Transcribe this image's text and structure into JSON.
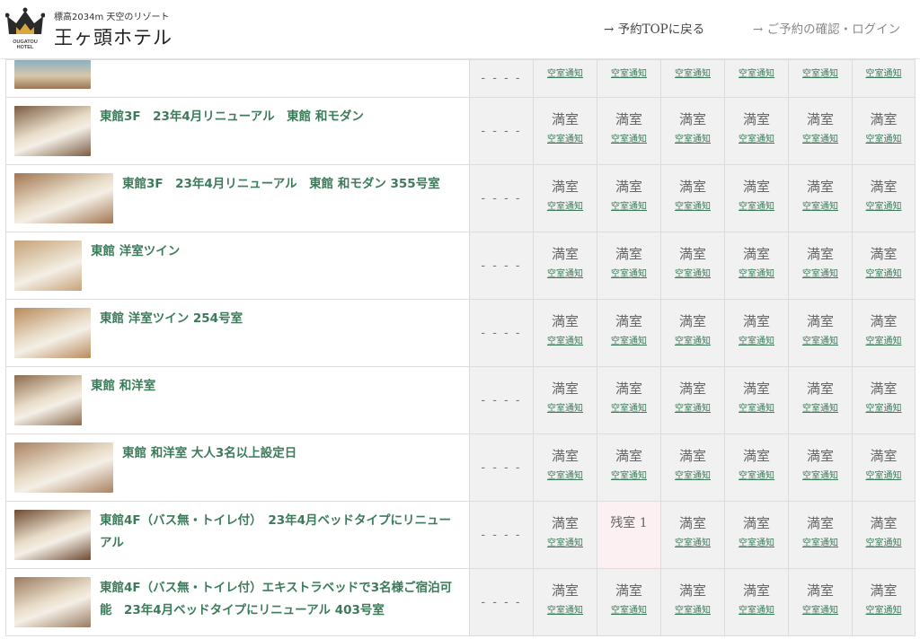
{
  "header": {
    "logo_text": "OUGATOU HOTEL",
    "tagline": "標高2034m 天空のリゾート",
    "hotel_name": "王ヶ頭ホテル",
    "nav_top": "→ 予約TOPに戻る",
    "nav_login": "→ ご予約の確認・ログイン"
  },
  "labels": {
    "full": "満室",
    "notify": "空室通知",
    "dash": "- - - -"
  },
  "partial_row": {
    "dash": "- - - -",
    "days": [
      {
        "notify": "空室通知"
      },
      {
        "notify": "空室通知"
      },
      {
        "notify": "空室通知"
      },
      {
        "notify": "空室通知"
      },
      {
        "notify": "空室通知"
      },
      {
        "notify": "空室通知"
      }
    ]
  },
  "rooms": [
    {
      "name": "東館3F　23年4月リニューアル　東館 和モダン",
      "thumb_color": "#7a5b43",
      "days": [
        {
          "status": "満室",
          "notify": "空室通知"
        },
        {
          "status": "満室",
          "notify": "空室通知"
        },
        {
          "status": "満室",
          "notify": "空室通知"
        },
        {
          "status": "満室",
          "notify": "空室通知"
        },
        {
          "status": "満室",
          "notify": "空室通知"
        },
        {
          "status": "満室",
          "notify": "空室通知"
        }
      ]
    },
    {
      "name": "東館3F　23年4月リニューアル　東館 和モダン 355号室",
      "thumb_color": "#a27550",
      "days": [
        {
          "status": "満室",
          "notify": "空室通知"
        },
        {
          "status": "満室",
          "notify": "空室通知"
        },
        {
          "status": "満室",
          "notify": "空室通知"
        },
        {
          "status": "満室",
          "notify": "空室通知"
        },
        {
          "status": "満室",
          "notify": "空室通知"
        },
        {
          "status": "満室",
          "notify": "空室通知"
        }
      ]
    },
    {
      "name": "東館 洋室ツイン",
      "thumb_color": "#c7a27a",
      "days": [
        {
          "status": "満室",
          "notify": "空室通知"
        },
        {
          "status": "満室",
          "notify": "空室通知"
        },
        {
          "status": "満室",
          "notify": "空室通知"
        },
        {
          "status": "満室",
          "notify": "空室通知"
        },
        {
          "status": "満室",
          "notify": "空室通知"
        },
        {
          "status": "満室",
          "notify": "空室通知"
        }
      ]
    },
    {
      "name": "東館 洋室ツイン 254号室",
      "thumb_color": "#b98a5c",
      "days": [
        {
          "status": "満室",
          "notify": "空室通知"
        },
        {
          "status": "満室",
          "notify": "空室通知"
        },
        {
          "status": "満室",
          "notify": "空室通知"
        },
        {
          "status": "満室",
          "notify": "空室通知"
        },
        {
          "status": "満室",
          "notify": "空室通知"
        },
        {
          "status": "満室",
          "notify": "空室通知"
        }
      ]
    },
    {
      "name": "東館 和洋室",
      "thumb_color": "#8c6a4e",
      "days": [
        {
          "status": "満室",
          "notify": "空室通知"
        },
        {
          "status": "満室",
          "notify": "空室通知"
        },
        {
          "status": "満室",
          "notify": "空室通知"
        },
        {
          "status": "満室",
          "notify": "空室通知"
        },
        {
          "status": "満室",
          "notify": "空室通知"
        },
        {
          "status": "満室",
          "notify": "空室通知"
        }
      ]
    },
    {
      "name": "東館 和洋室 大人3名以上設定日",
      "thumb_color": "#a98263",
      "days": [
        {
          "status": "満室",
          "notify": "空室通知"
        },
        {
          "status": "満室",
          "notify": "空室通知"
        },
        {
          "status": "満室",
          "notify": "空室通知"
        },
        {
          "status": "満室",
          "notify": "空室通知"
        },
        {
          "status": "満室",
          "notify": "空室通知"
        },
        {
          "status": "満室",
          "notify": "空室通知"
        }
      ]
    },
    {
      "name": "東館4F（バス無・トイレ付）　23年4月ベッドタイプにリニューアル",
      "thumb_color": "#6e4a32",
      "days": [
        {
          "status": "満室",
          "notify": "空室通知"
        },
        {
          "status": "残室 1",
          "notify": "",
          "vacant": true
        },
        {
          "status": "満室",
          "notify": "空室通知"
        },
        {
          "status": "満室",
          "notify": "空室通知"
        },
        {
          "status": "満室",
          "notify": "空室通知"
        },
        {
          "status": "満室",
          "notify": "空室通知"
        }
      ]
    },
    {
      "name": "東館4F（バス無・トイレ付）エキストラベッドで3名様ご宿泊可能　23年4月ベッドタイプにリニューアル 403号室",
      "thumb_color": "#9a7a60",
      "days": [
        {
          "status": "満室",
          "notify": "空室通知"
        },
        {
          "status": "満室",
          "notify": "空室通知"
        },
        {
          "status": "満室",
          "notify": "空室通知"
        },
        {
          "status": "満室",
          "notify": "空室通知"
        },
        {
          "status": "満室",
          "notify": "空室通知"
        },
        {
          "status": "満室",
          "notify": "空室通知"
        }
      ]
    }
  ]
}
